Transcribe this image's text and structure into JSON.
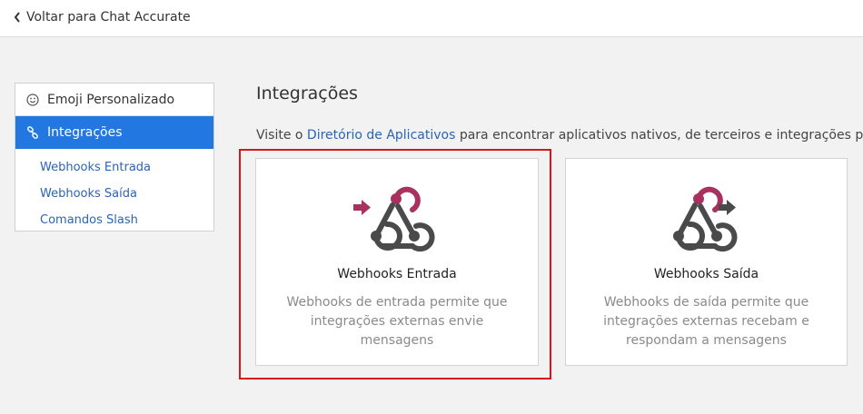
{
  "topbar": {
    "back_label": "Voltar para Chat Accurate"
  },
  "sidebar": {
    "items": [
      {
        "label": "Emoji Personalizado",
        "icon": "smiley-icon"
      },
      {
        "label": "Integrações",
        "icon": "link-icon",
        "active": true
      }
    ],
    "subitems": [
      {
        "label": "Webhooks Entrada"
      },
      {
        "label": "Webhooks Saída"
      },
      {
        "label": "Comandos Slash"
      }
    ]
  },
  "main": {
    "title": "Integrações",
    "intro": {
      "prefix": "Visite o ",
      "link": "Diretório de Aplicativos",
      "suffix": " para encontrar aplicativos nativos, de terceiros e integrações para o Ma"
    },
    "cards": [
      {
        "title": "Webhooks Entrada",
        "description": "Webhooks de entrada permite que integrações externas envie mensagens",
        "icon": "incoming-webhook-icon"
      },
      {
        "title": "Webhooks Saída",
        "description": "Webhooks de saída permite que integrações externas recebam e respondam a mensagens",
        "icon": "outgoing-webhook-icon"
      }
    ]
  },
  "colors": {
    "accent": "#2277e0",
    "link": "#2a64b5",
    "webhook_red": "#a8315f",
    "webhook_gray": "#4a4a4a",
    "highlight": "#d9151b"
  }
}
